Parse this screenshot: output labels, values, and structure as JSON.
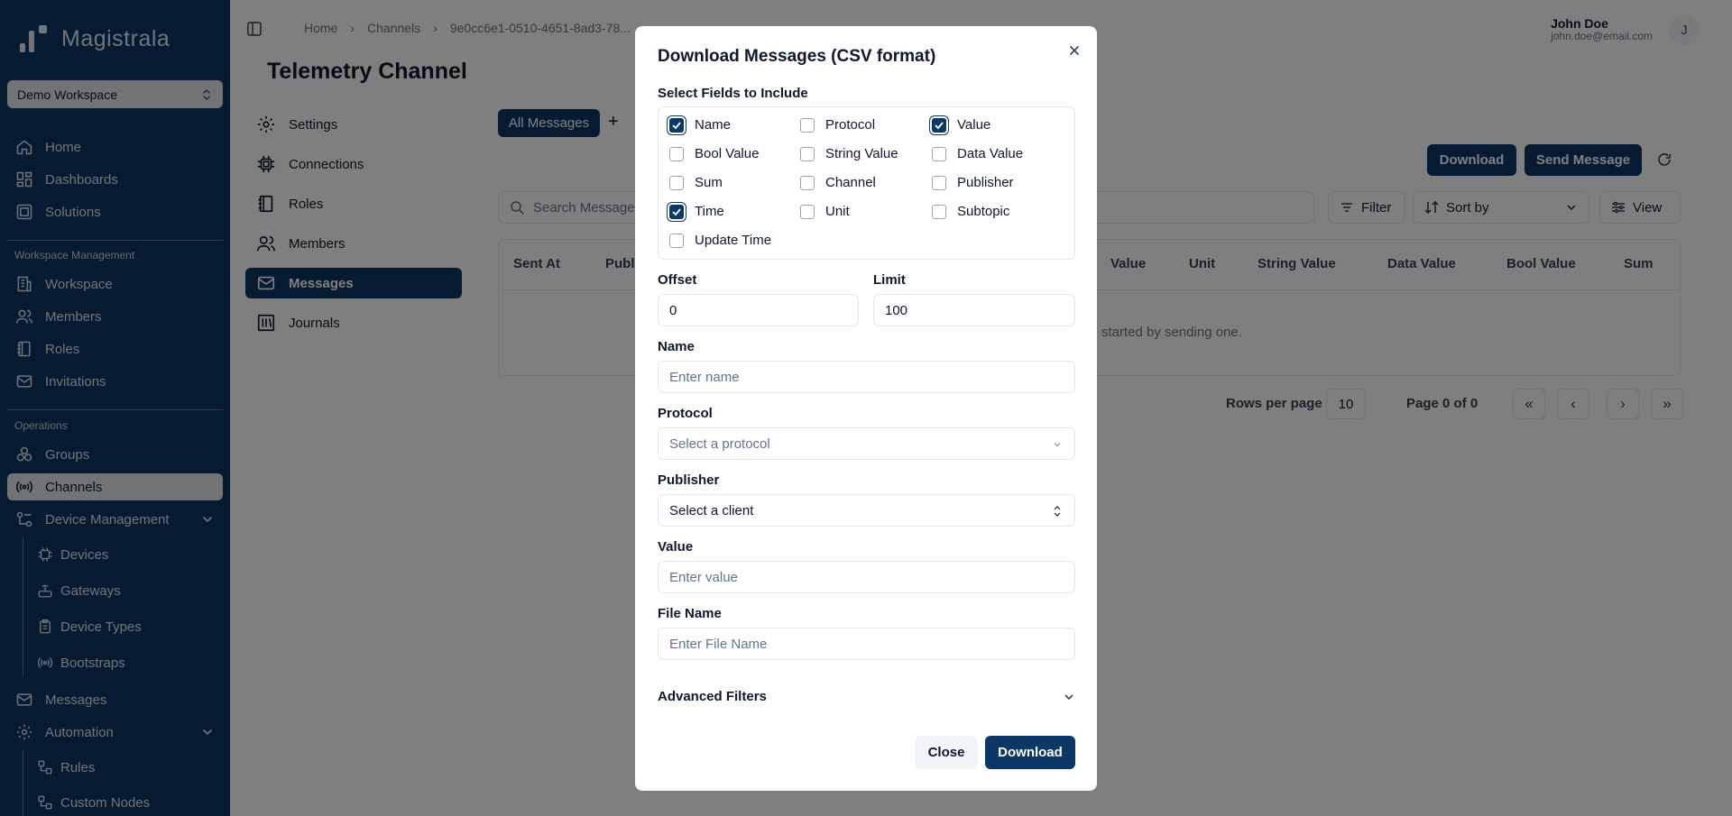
{
  "app": {
    "logo_text": "Magistrala",
    "workspace": "Demo Workspace"
  },
  "sidebar": {
    "main": [
      {
        "label": "Home",
        "icon": "home-icon"
      },
      {
        "label": "Dashboards",
        "icon": "dashboard-icon"
      },
      {
        "label": "Solutions",
        "icon": "solutions-icon"
      }
    ],
    "section_workspace": "Workspace Management",
    "workspace_items": [
      {
        "label": "Workspace",
        "icon": "building-icon"
      },
      {
        "label": "Members",
        "icon": "users-icon"
      },
      {
        "label": "Roles",
        "icon": "book-icon"
      },
      {
        "label": "Invitations",
        "icon": "mail-icon"
      }
    ],
    "section_operations": "Operations",
    "ops_items": [
      {
        "label": "Groups",
        "icon": "groups-icon"
      },
      {
        "label": "Channels",
        "icon": "radio-icon",
        "active": true
      },
      {
        "label": "Device Management",
        "icon": "device-management-icon"
      }
    ],
    "device_sub": [
      {
        "label": "Devices",
        "icon": "cpu-icon"
      },
      {
        "label": "Gateways",
        "icon": "router-icon"
      },
      {
        "label": "Device Types",
        "icon": "clipboard-icon"
      },
      {
        "label": "Bootstraps",
        "icon": "signal-icon"
      }
    ],
    "messages": "Messages",
    "automation": "Automation",
    "automation_sub": [
      {
        "label": "Rules",
        "icon": "workflow-icon"
      },
      {
        "label": "Custom Nodes",
        "icon": "workflow-icon"
      }
    ]
  },
  "header": {
    "breadcrumb": [
      "Home",
      "Channels",
      "9e0cc6e1-0510-4651-8ad3-78..."
    ],
    "user_name": "John Doe",
    "user_email": "john.doe@email.com",
    "avatar_initial": "J"
  },
  "page": {
    "title": "Telemetry Channel",
    "menu": [
      {
        "label": "Settings",
        "icon": "gear-icon"
      },
      {
        "label": "Connections",
        "icon": "chip-icon"
      },
      {
        "label": "Roles",
        "icon": "book-icon"
      },
      {
        "label": "Members",
        "icon": "users-icon"
      },
      {
        "label": "Messages",
        "icon": "mail-icon",
        "active": true
      },
      {
        "label": "Journals",
        "icon": "library-icon"
      }
    ]
  },
  "messages_panel": {
    "tab_all": "All Messages",
    "tab_add": "+",
    "download_label": "Download",
    "send_label": "Send Message",
    "search_placeholder": "Search Message",
    "filter_label": "Filter",
    "sort_label": "Sort by",
    "view_label": "View",
    "columns": [
      "Sent At",
      "Publi",
      "Value",
      "Unit",
      "String Value",
      "Data Value",
      "Bool Value",
      "Sum"
    ],
    "empty_text": "started by sending one.",
    "rows_per_page_label": "Rows per page",
    "rows_per_page": "10",
    "page_info": "Page 0 of 0",
    "pager": [
      "«",
      "‹",
      "›",
      "»"
    ]
  },
  "modal": {
    "title": "Download Messages (CSV format)",
    "fields_label": "Select Fields to Include",
    "fields": [
      {
        "label": "Name",
        "checked": true
      },
      {
        "label": "Protocol",
        "checked": false
      },
      {
        "label": "Value",
        "checked": true
      },
      {
        "label": "Bool Value",
        "checked": false
      },
      {
        "label": "String Value",
        "checked": false
      },
      {
        "label": "Data Value",
        "checked": false
      },
      {
        "label": "Sum",
        "checked": false
      },
      {
        "label": "Channel",
        "checked": false
      },
      {
        "label": "Publisher",
        "checked": false
      },
      {
        "label": "Time",
        "checked": true
      },
      {
        "label": "Unit",
        "checked": false
      },
      {
        "label": "Subtopic",
        "checked": false
      },
      {
        "label": "Update Time",
        "checked": false
      }
    ],
    "offset_label": "Offset",
    "offset_value": "0",
    "limit_label": "Limit",
    "limit_value": "100",
    "name_label": "Name",
    "name_placeholder": "Enter name",
    "protocol_label": "Protocol",
    "protocol_placeholder": "Select a protocol",
    "publisher_label": "Publisher",
    "publisher_placeholder": "Select a client",
    "value_label": "Value",
    "value_placeholder": "Enter value",
    "filename_label": "File Name",
    "filename_placeholder": "Enter File Name",
    "advanced_label": "Advanced Filters",
    "close_label": "Close",
    "download_label": "Download"
  },
  "colors": {
    "brand": "#0d3764",
    "overlay": "rgba(0,0,0,0.5)"
  }
}
